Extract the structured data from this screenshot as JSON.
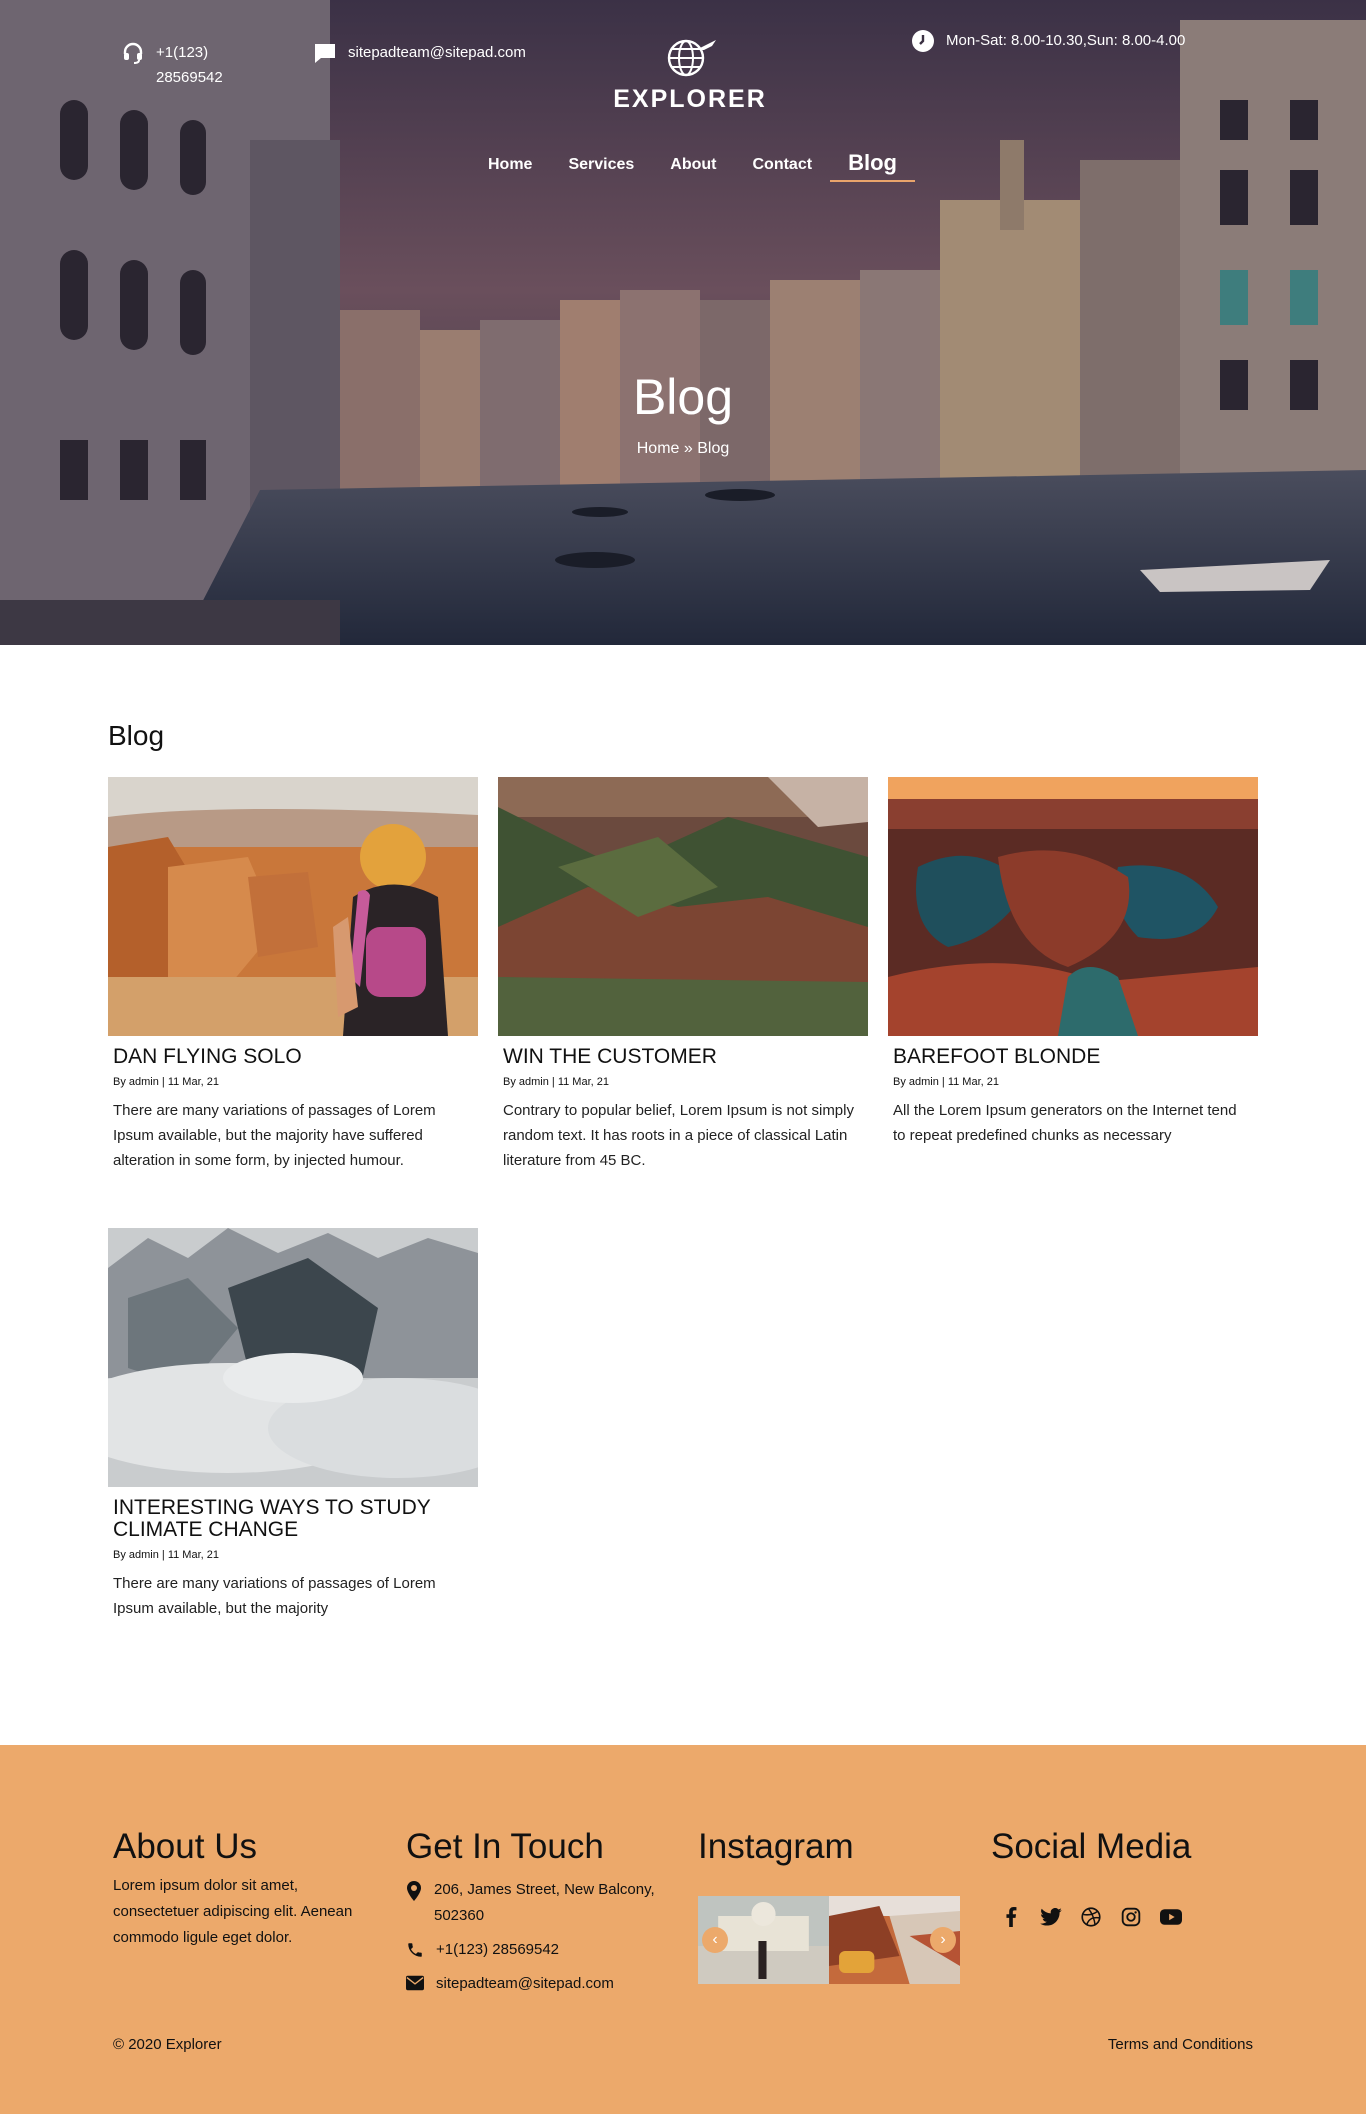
{
  "header": {
    "phone": "+1(123) 28569542",
    "email": "sitepadteam@sitepad.com",
    "hours": "Mon-Sat: 8.00-10.30,Sun: 8.00-4.00",
    "logo_text": "EXPLORER",
    "nav": [
      {
        "label": "Home"
      },
      {
        "label": "Services"
      },
      {
        "label": "About"
      },
      {
        "label": "Contact"
      },
      {
        "label": "Blog"
      }
    ],
    "page_title": "Blog",
    "breadcrumb_home": "Home",
    "breadcrumb_sep": "»",
    "breadcrumb_current": "Blog"
  },
  "blog": {
    "section_title": "Blog",
    "posts": [
      {
        "title": "DAN FLYING SOLO",
        "meta": "By admin | 11 Mar, 21",
        "excerpt": "There are many variations of passages of Lorem Ipsum available, but the majority have suffered alteration in some form, by injected humour."
      },
      {
        "title": "WIN THE CUSTOMER",
        "meta": "By admin | 11 Mar, 21",
        "excerpt": "Contrary to popular belief, Lorem Ipsum is not simply random text. It has roots in a piece of classical Latin literature from 45 BC."
      },
      {
        "title": "BAREFOOT BLONDE",
        "meta": "By admin | 11 Mar, 21",
        "excerpt": "All the Lorem Ipsum generators on the Internet tend to repeat predefined chunks as necessary"
      },
      {
        "title": "INTERESTING WAYS TO STUDY CLIMATE CHANGE",
        "meta": "By admin | 11 Mar, 21",
        "excerpt": "There are many variations of passages of Lorem Ipsum available, but the majority"
      }
    ]
  },
  "footer": {
    "about_title": "About Us",
    "about_text": "Lorem ipsum dolor sit amet, consectetuer adipiscing elit. Aenean commodo ligule eget dolor.",
    "contact_title": "Get In Touch",
    "address": "206, James Street, New Balcony, 502360",
    "phone": "+1(123) 28569542",
    "email": "sitepadteam@sitepad.com",
    "instagram_title": "Instagram",
    "social_title": "Social Media",
    "social_icons": [
      "facebook-icon",
      "twitter-icon",
      "dribbble-icon",
      "instagram-icon",
      "youtube-icon"
    ],
    "copyright": "© 2020 Explorer",
    "terms": "Terms and Conditions"
  },
  "colors": {
    "accent": "#eca96b",
    "hero_overlay": "#3a3042"
  }
}
